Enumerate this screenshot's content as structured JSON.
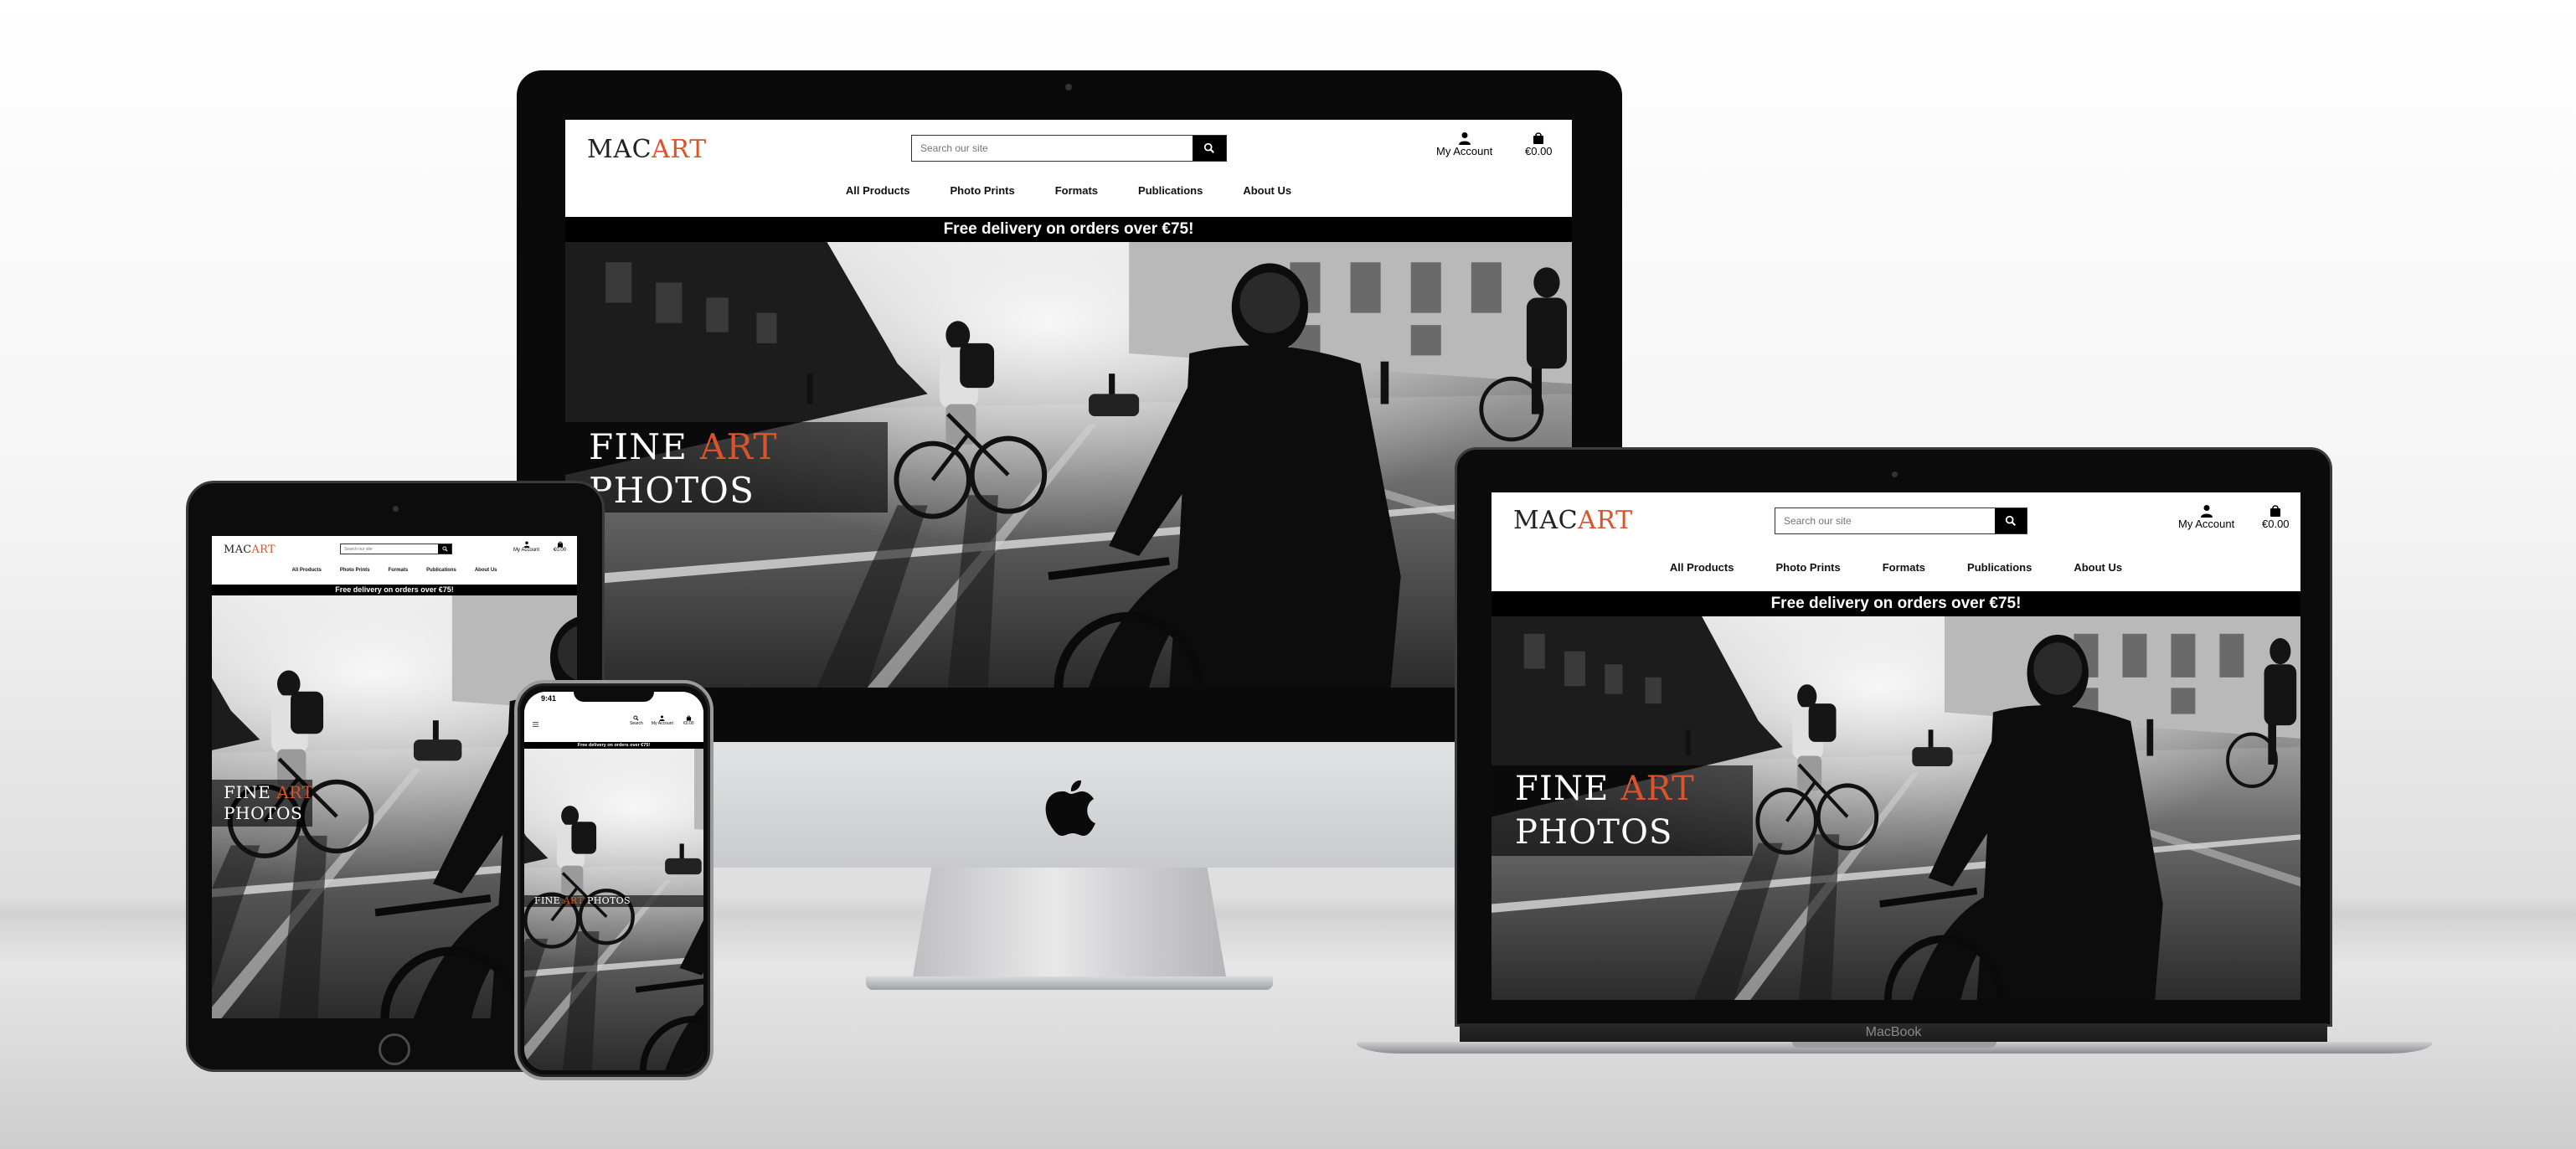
{
  "site": {
    "logo_part1": "MAC",
    "logo_part2": "ART",
    "search_placeholder": "Search our site",
    "account_label": "My Account",
    "bag_total": "€0.00",
    "nav": [
      "All Products",
      "Photo Prints",
      "Formats",
      "Publications",
      "About Us"
    ],
    "banner": "Free delivery on orders over €75!",
    "hero_word1": "FINE",
    "hero_word2": "ART",
    "hero_word3": "PHOTOS"
  },
  "mobile": {
    "status_time": "9:41",
    "search_label": "Search"
  },
  "devices": {
    "macbook_label": "MacBook"
  },
  "colors": {
    "accent": "#d9542a",
    "banner_bg": "#000000",
    "page_bg": "#ffffff"
  },
  "icons": [
    "search-icon",
    "user-icon",
    "shopping-bag-icon",
    "apple-logo-icon",
    "menu-icon"
  ]
}
